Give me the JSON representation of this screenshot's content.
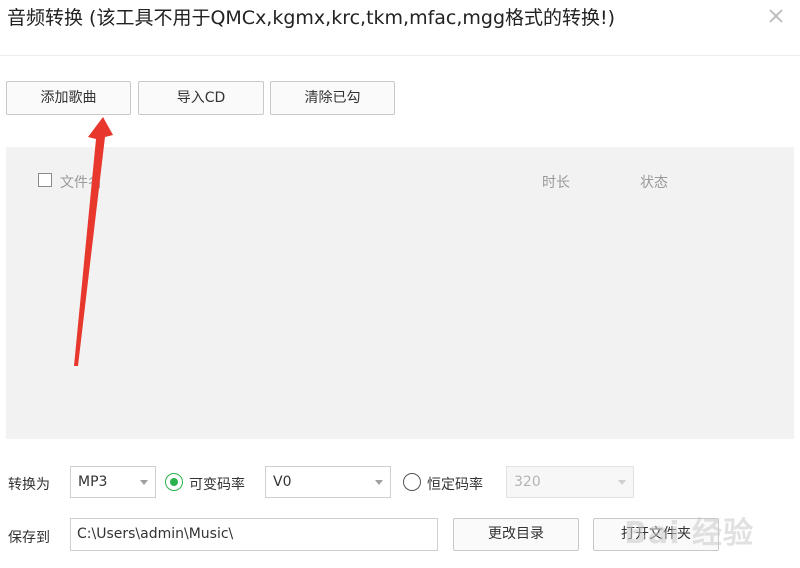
{
  "window": {
    "title": "音频转换 (该工具不用于QMCx,kgmx,krc,tkm,mfac,mgg格式的转换!)"
  },
  "toolbar": {
    "add_label": "添加歌曲",
    "import_label": "导入CD",
    "clear_label": "清除已勾"
  },
  "list": {
    "columns": {
      "filename": "文件名",
      "duration": "时长",
      "status": "状态"
    }
  },
  "convert": {
    "label": "转换为",
    "format": "MP3",
    "vbr_label": "可变码率",
    "vbr_value": "V0",
    "cbr_label": "恒定码率",
    "cbr_value": "320",
    "selected_mode": "vbr"
  },
  "save": {
    "label": "保存到",
    "path": "C:\\Users\\admin\\Music\\",
    "change_dir_label": "更改目录",
    "open_folder_label": "打开文件夹"
  },
  "colors": {
    "accent": "#2bb24c",
    "annotation_arrow": "#e8372c"
  },
  "watermark": "Bai 经验"
}
